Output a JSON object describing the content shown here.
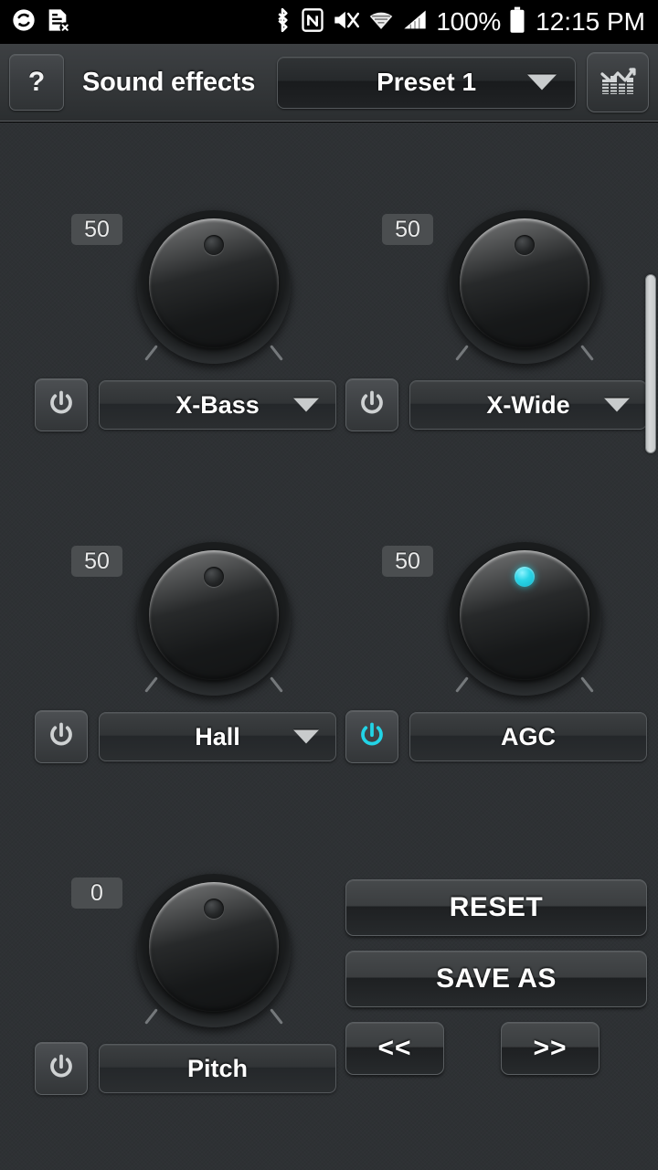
{
  "statusbar": {
    "left_icons": [
      {
        "name": "sync-circle-icon",
        "label": "sync"
      },
      {
        "name": "sim-card-error-icon",
        "label": "no-sim"
      }
    ],
    "right_icons": [
      {
        "name": "bluetooth-icon",
        "label": "bluetooth"
      },
      {
        "name": "nfc-icon",
        "label": "nfc"
      },
      {
        "name": "mute-icon",
        "label": "sound-off"
      },
      {
        "name": "wifi-icon",
        "label": "wifi"
      },
      {
        "name": "cellular-signal-icon",
        "label": "signal"
      }
    ],
    "battery_percent": "100%",
    "battery_icon": "battery-full-icon",
    "clock": "12:15 PM"
  },
  "header": {
    "help_label": "?",
    "help_icon": "question-mark-icon",
    "title": "Sound effects",
    "preset_value": "Preset 1",
    "preset_caret_icon": "chevron-down-icon",
    "eq_icon": "equalizer-icon"
  },
  "colors": {
    "background": "#2e3134",
    "header": "#35383a",
    "accent_cyan": "#22d4e6",
    "text": "#ffffff",
    "badge": "#4b4e50",
    "scrollbar": "#d0d3d4"
  },
  "effects": [
    {
      "id": "x-bass",
      "value": "50",
      "label": "X-Bass",
      "power_on": false,
      "power_icon": "power-icon",
      "has_caret": true,
      "caret_icon": "chevron-down-icon",
      "knob_indicator": "knob-indicator-dot"
    },
    {
      "id": "x-wide",
      "value": "50",
      "label": "X-Wide",
      "power_on": false,
      "power_icon": "power-icon",
      "has_caret": true,
      "caret_icon": "chevron-down-icon",
      "knob_indicator": "knob-indicator-dot"
    },
    {
      "id": "hall",
      "value": "50",
      "label": "Hall",
      "power_on": false,
      "power_icon": "power-icon",
      "has_caret": true,
      "caret_icon": "chevron-down-icon",
      "knob_indicator": "knob-indicator-dot"
    },
    {
      "id": "agc",
      "value": "50",
      "label": "AGC",
      "power_on": true,
      "power_icon": "power-icon",
      "has_caret": false,
      "caret_icon": "",
      "knob_indicator": "knob-indicator-dot-active"
    },
    {
      "id": "pitch",
      "value": "0",
      "label": "Pitch",
      "power_on": false,
      "power_icon": "power-icon",
      "has_caret": false,
      "caret_icon": "",
      "knob_indicator": "knob-indicator-dot"
    }
  ],
  "actions": {
    "reset_label": "RESET",
    "save_as_label": "SAVE AS",
    "prev_label": "<<",
    "next_label": ">>"
  },
  "scrollbar": {
    "name": "vertical-scrollbar"
  }
}
